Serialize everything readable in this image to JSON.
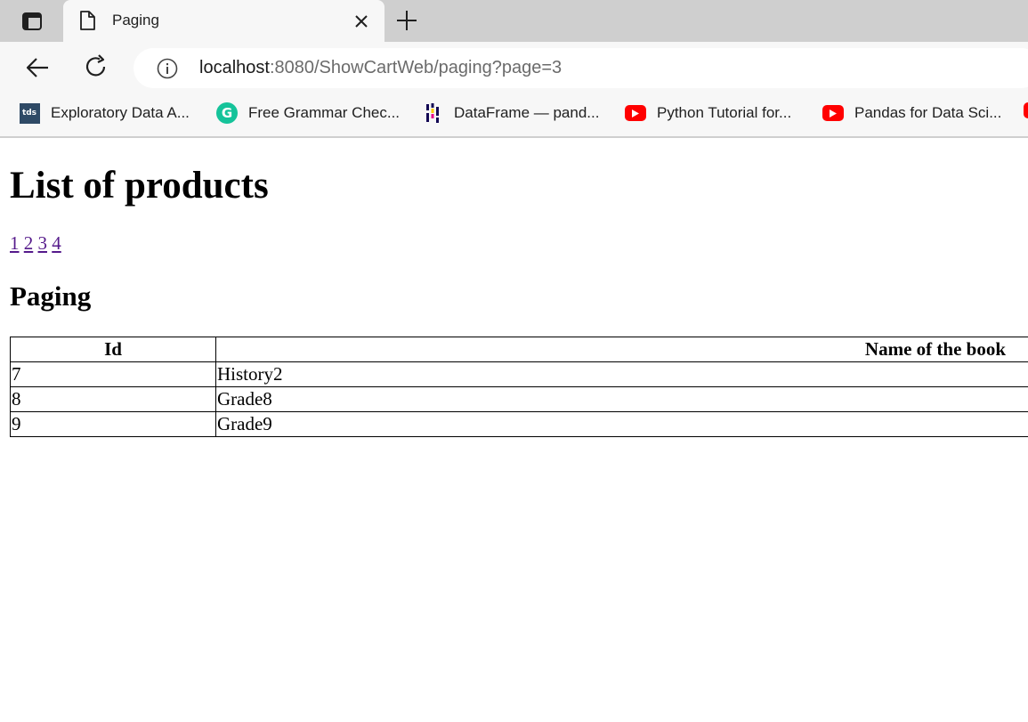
{
  "browser": {
    "tab": {
      "title": "Paging"
    },
    "address": {
      "host": "localhost",
      "rest": ":8080/ShowCartWeb/paging?page=3"
    },
    "bookmarks": [
      {
        "label": "Exploratory Data A...",
        "icon": "tds-icon",
        "icon_text": "tds"
      },
      {
        "label": "Free Grammar Chec...",
        "icon": "grammarly-icon",
        "icon_text": "G"
      },
      {
        "label": "DataFrame — pand...",
        "icon": "pandas-icon"
      },
      {
        "label": "Python Tutorial for...",
        "icon": "youtube-icon"
      },
      {
        "label": "Pandas for Data Sci...",
        "icon": "youtube-icon"
      }
    ]
  },
  "page": {
    "title": "List of products",
    "pages": [
      "1",
      "2",
      "3",
      "4"
    ],
    "section_title": "Paging",
    "table": {
      "headers": [
        "Id",
        "Name of the book"
      ],
      "rows": [
        {
          "id": "7",
          "name": "History2"
        },
        {
          "id": "8",
          "name": "Grade8"
        },
        {
          "id": "9",
          "name": "Grade9"
        }
      ]
    }
  },
  "colors": {
    "link": "#551a8b",
    "youtube": "#ff0000",
    "grammarly": "#15c39a",
    "tds": "#2f4a66"
  }
}
